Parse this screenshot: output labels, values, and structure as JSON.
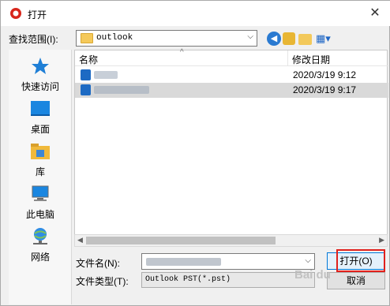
{
  "window": {
    "title": "打开",
    "close_glyph": "✕"
  },
  "lookin": {
    "label": "查找范围(I):",
    "value": "outlook"
  },
  "places": [
    {
      "label": "快速访问",
      "icon": "star-icon"
    },
    {
      "label": "桌面",
      "icon": "desktop-icon"
    },
    {
      "label": "库",
      "icon": "library-icon"
    },
    {
      "label": "此电脑",
      "icon": "computer-icon"
    },
    {
      "label": "网络",
      "icon": "network-icon"
    }
  ],
  "filelist": {
    "columns": [
      "名称",
      "修改日期"
    ],
    "rows": [
      {
        "name": "",
        "date": "2020/3/19 9:12",
        "selected": false
      },
      {
        "name": "",
        "date": "2020/3/19 9:17",
        "selected": true
      }
    ]
  },
  "filename": {
    "label": "文件名(N):",
    "value": ""
  },
  "filetype": {
    "label": "文件类型(T):",
    "value": "Outlook PST(*.pst)"
  },
  "buttons": {
    "open": "打开(O)",
    "cancel": "取消"
  },
  "watermark": "Bai du"
}
